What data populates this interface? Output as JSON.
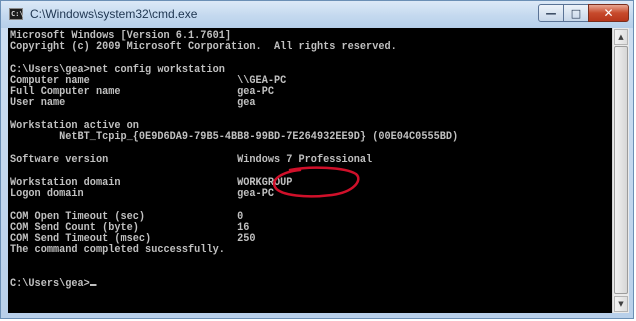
{
  "window": {
    "title": "C:\\Windows\\system32\\cmd.exe",
    "minimize_glyph": "—",
    "maximize_glyph": "□",
    "close_glyph": "✕",
    "icon": "cmd-app-icon"
  },
  "console": {
    "lines": {
      "l01": "Microsoft Windows [Version 6.1.7601]",
      "l02": "Copyright (c) 2009 Microsoft Corporation.  All rights reserved.",
      "l03": "C:\\Users\\gea>net config workstation",
      "l04": "Computer name                        \\\\GEA-PC",
      "l05": "Full Computer name                   gea-PC",
      "l06": "User name                            gea",
      "l07": "Workstation active on",
      "l08": "        NetBT_Tcpip_{0E9D6DA9-79B5-4BB8-99BD-7E264932EE9D} (00E04C0555BD)",
      "l09": "Software version                     Windows 7 Professional",
      "l10": "Workstation domain                   WORKGROUP",
      "l11": "Logon domain                         gea-PC",
      "l12": "COM Open Timeout (sec)               0",
      "l13": "COM Send Count (byte)                16",
      "l14": "COM Send Timeout (msec)              250",
      "l15": "The command completed successfully.",
      "l16": "C:\\Users\\gea>"
    }
  },
  "scrollbar": {
    "up_glyph": "▲",
    "down_glyph": "▼"
  },
  "colors": {
    "console_background": "#000000",
    "console_text": "#c0c0c0",
    "annotation": "#d0102a"
  }
}
